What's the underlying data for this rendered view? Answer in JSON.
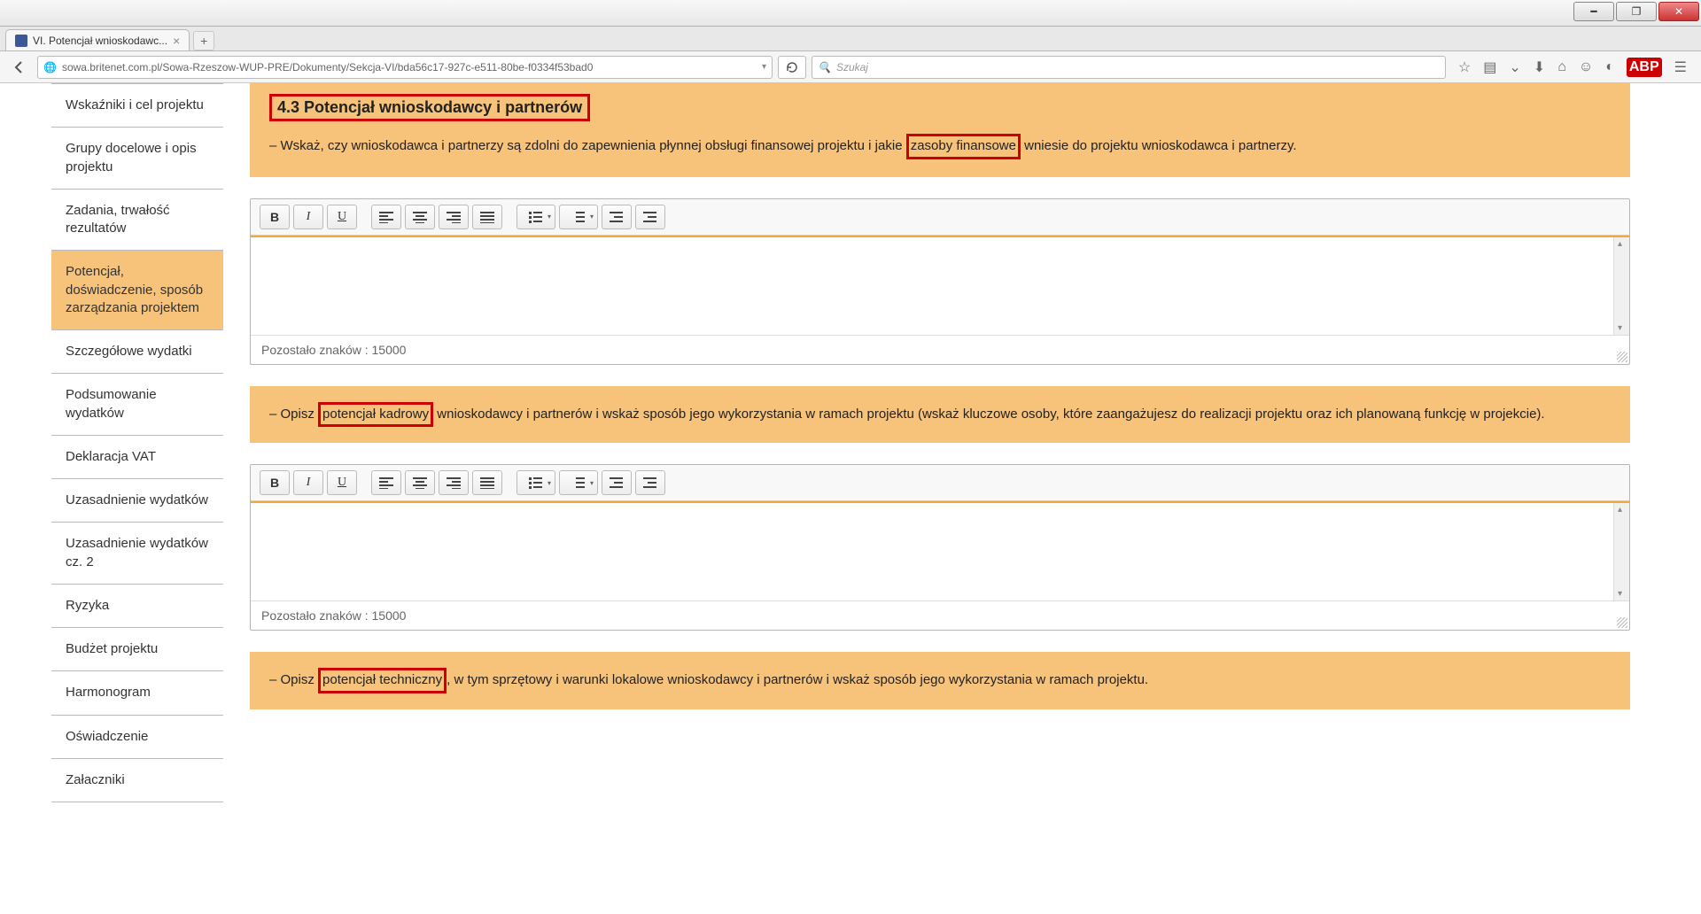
{
  "window": {
    "title": "VI. Potencjał wnioskodawc..."
  },
  "browser": {
    "url": "sowa.britenet.com.pl/Sowa-Rzeszow-WUP-PRE/Dokumenty/Sekcja-VI/bda56c17-927c-e511-80be-f0334f53bad0",
    "search_placeholder": "Szukaj"
  },
  "sidebar": {
    "items": [
      {
        "label": "Wskaźniki i cel projektu"
      },
      {
        "label": "Grupy docelowe i opis projektu"
      },
      {
        "label": "Zadania, trwałość rezultatów"
      },
      {
        "label": "Potencjał, doświadczenie, sposób zarządzania projektem"
      },
      {
        "label": "Szczegółowe wydatki"
      },
      {
        "label": "Podsumowanie wydatków"
      },
      {
        "label": "Deklaracja VAT"
      },
      {
        "label": "Uzasadnienie wydatków"
      },
      {
        "label": "Uzasadnienie wydatków cz. 2"
      },
      {
        "label": "Ryzyka"
      },
      {
        "label": "Budżet projektu"
      },
      {
        "label": "Harmonogram"
      },
      {
        "label": "Oświadczenie"
      },
      {
        "label": "Załaczniki"
      }
    ]
  },
  "content": {
    "section_title": "4.3 Potencjał wnioskodawcy i partnerów",
    "desc1_a": "– Wskaż, czy wnioskodawca i partnerzy są zdolni do zapewnienia płynnej obsługi finansowej projektu i jakie ",
    "desc1_hl": "zasoby finansowe",
    "desc1_b": " wniesie do projektu wnioskodawca i partnerzy.",
    "counter1": "Pozostało znaków : 15000",
    "desc2_a": "– Opisz ",
    "desc2_hl": "potencjał kadrowy",
    "desc2_b": " wnioskodawcy i partnerów i wskaż sposób jego wykorzystania w ramach projektu (wskaż kluczowe osoby, które zaangażujesz do realizacji projektu oraz ich planowaną funkcję w projekcie).",
    "counter2": "Pozostało znaków : 15000",
    "desc3_a": "– Opisz ",
    "desc3_hl": "potencjał techniczny",
    "desc3_b": ", w tym sprzętowy i warunki lokalowe wnioskodawcy i partnerów i wskaż sposób jego wykorzystania w ramach projektu."
  },
  "toolbar": {
    "bold": "B",
    "italic": "I",
    "underline": "U"
  }
}
